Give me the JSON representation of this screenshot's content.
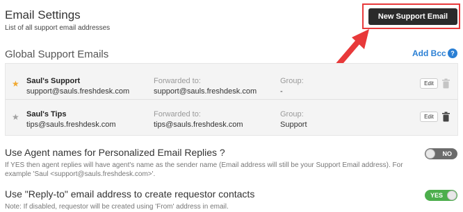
{
  "header": {
    "title": "Email Settings",
    "subtitle": "List of all support email addresses",
    "new_email_button": "New Support Email"
  },
  "global_section": {
    "title": "Global Support Emails",
    "add_bcc": "Add Bcc",
    "help_icon": "?"
  },
  "emails": [
    {
      "name": "Saul's Support",
      "address": "support@sauls.freshdesk.com",
      "forwarded_label": "Forwarded to:",
      "forwarded_value": "support@sauls.freshdesk.com",
      "group_label": "Group:",
      "group_value": "-",
      "edit_label": "Edit",
      "primary": true
    },
    {
      "name": "Saul's Tips",
      "address": "tips@sauls.freshdesk.com",
      "forwarded_label": "Forwarded to:",
      "forwarded_value": "tips@sauls.freshdesk.com",
      "group_label": "Group:",
      "group_value": "Support",
      "edit_label": "Edit",
      "primary": false
    }
  ],
  "settings": [
    {
      "title": "Use Agent names for Personalized Email Replies ?",
      "note": "If YES then agent replies will have agent's name as the sender name (Email address will still be your Support Email address). For example 'Saul <support@sauls.freshdesk.com>'.",
      "toggle_label": "NO",
      "enabled": false
    },
    {
      "title": "Use \"Reply-to\" email address to create requestor contacts",
      "note": "Note: If disabled, requestor will be created using 'From' address in email.",
      "toggle_label": "YES",
      "enabled": true
    }
  ],
  "colors": {
    "accent_link": "#2a7fd4",
    "highlight": "#e8393a",
    "primary_button": "#2b2b2b",
    "star_active": "#f0a830",
    "toggle_on": "#4cae4c",
    "toggle_off": "#6b6b6b"
  },
  "icons": {
    "star": "star-icon",
    "trash": "trash-icon",
    "help": "help-icon",
    "arrow": "arrow-annotation-icon"
  }
}
